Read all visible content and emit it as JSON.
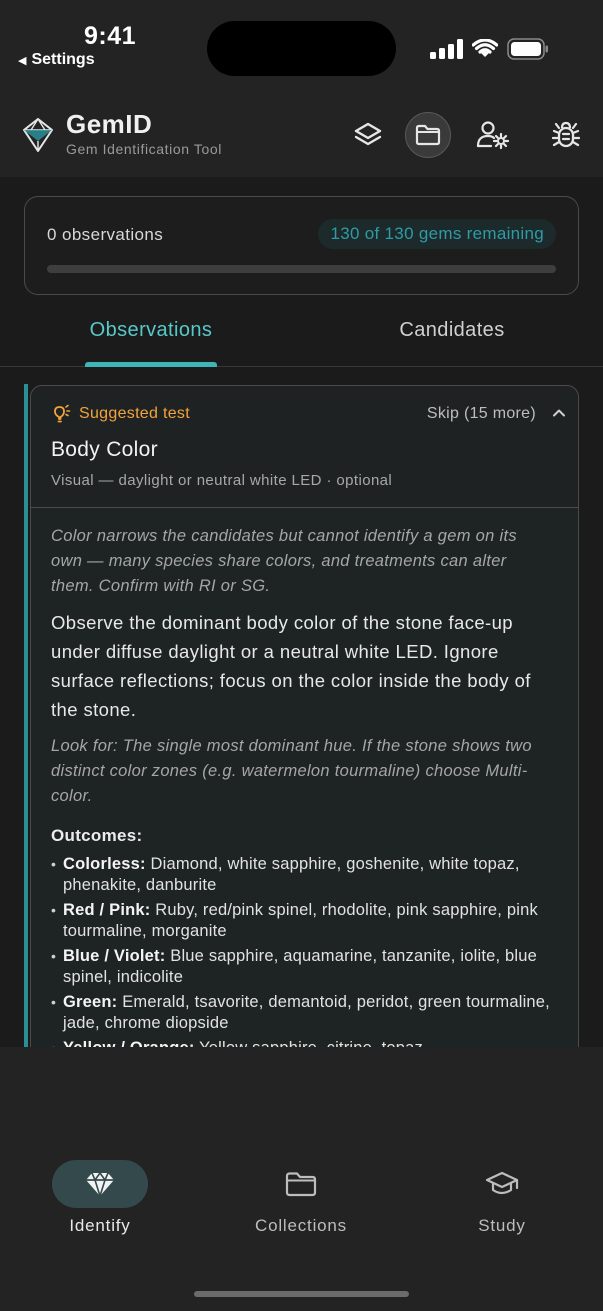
{
  "status_bar": {
    "time": "9:41",
    "back_label": "Settings",
    "icons": [
      "cellular-signal-icon",
      "wifi-icon",
      "battery-icon"
    ]
  },
  "header": {
    "title": "GemID",
    "subtitle": "Gem Identification Tool",
    "actions": [
      "layers-icon",
      "folder-icon",
      "user-settings-icon",
      "bug-icon"
    ]
  },
  "progress": {
    "observations": "0 observations",
    "remaining": "130 of 130 gems remaining",
    "fraction": 0
  },
  "tabs": [
    "Observations",
    "Candidates"
  ],
  "test_card": {
    "suggested_label": "Suggested test",
    "skip_label": "Skip (15 more)",
    "title": "Body Color",
    "meta": "Visual — daylight or neutral white LED · optional",
    "note": "Color narrows the candidates but cannot identify a gem on its own — many species share colors, and treatments can alter them. Confirm with RI or SG.",
    "instructions": "Observe the dominant body color of the stone face-up under diffuse daylight or a neutral white LED. Ignore surface reflections; focus on the color inside the body of the stone.",
    "look_for": "Look for: The single most dominant hue. If the stone shows two distinct color zones (e.g. watermelon tourmaline) choose Multi-color.",
    "outcomes_label": "Outcomes:",
    "outcomes": [
      {
        "name": "Colorless:",
        "desc": "Diamond, white sapphire, goshenite, white topaz, phenakite, danburite"
      },
      {
        "name": "Red / Pink:",
        "desc": "Ruby, red/pink spinel, rhodolite, pink sapphire, pink tourmaline, morganite"
      },
      {
        "name": "Blue / Violet:",
        "desc": "Blue sapphire, aquamarine, tanzanite, iolite, blue spinel, indicolite"
      },
      {
        "name": "Green:",
        "desc": "Emerald, tsavorite, demantoid, peridot, green tourmaline, jade, chrome diopside"
      },
      {
        "name": "Yellow / Orange:",
        "desc": "Yellow sapphire, citrine, topaz"
      }
    ]
  },
  "bottom_nav": {
    "items": [
      {
        "label": "Identify",
        "icon": "diamond-icon",
        "active": true
      },
      {
        "label": "Collections",
        "icon": "folder-icon",
        "active": false
      },
      {
        "label": "Study",
        "icon": "graduation-cap-icon",
        "active": false
      }
    ]
  },
  "colors": {
    "accent": "#3fb5b8",
    "suggested": "#f3a33a",
    "background": "#1b1b1b"
  }
}
